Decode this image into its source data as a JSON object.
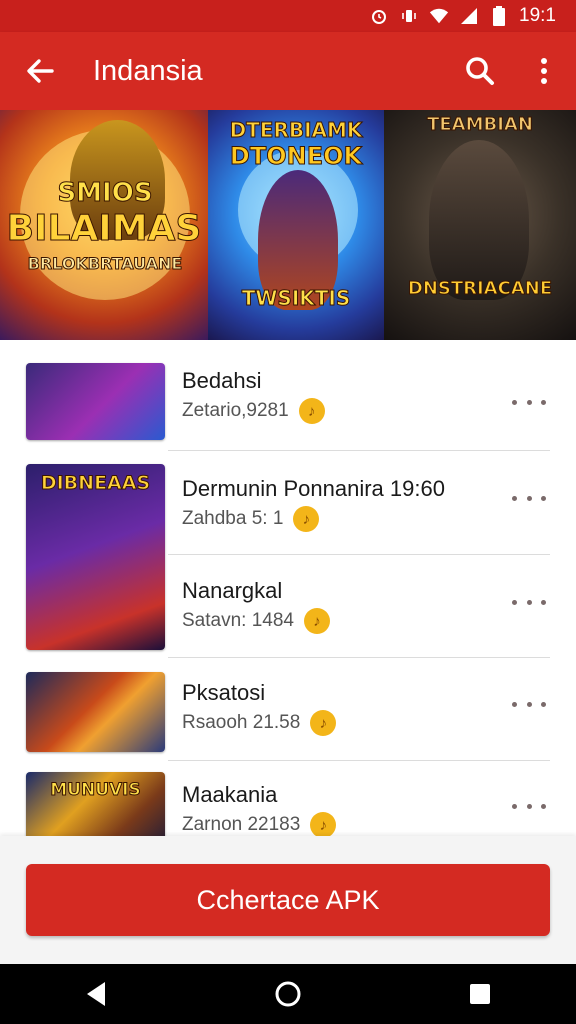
{
  "status_bar": {
    "time": "19:1",
    "icons": [
      "alarm-icon",
      "vibrate-icon",
      "wifi-icon",
      "signal-icon",
      "battery-icon"
    ]
  },
  "app_bar": {
    "title": "Indansia",
    "back_icon": "arrow-left-icon",
    "search_icon": "search-icon",
    "menu_icon": "more-vertical-icon"
  },
  "banner": {
    "tiles": [
      {
        "line1": "SMIOS",
        "line2": "BILAIMAS",
        "line3": "BRLOKBRTAUANE"
      },
      {
        "line1": "DTERBIAMK",
        "line2": "DTONEOK",
        "line3": "TWSIKTIS"
      },
      {
        "line1": "TEAMBIAN",
        "line2": "DNSTRIACANE"
      }
    ]
  },
  "apps": [
    {
      "name": "Bedahsi",
      "meta": "Zetario,9281"
    },
    {
      "name": "Dermunin Ponnanira 19:60",
      "meta": "Zahdba 5: 1"
    },
    {
      "name": "Nanargkal",
      "meta": "Satavn: 1484"
    },
    {
      "name": "Pksatosi",
      "meta": "Rsaooh 21.58"
    },
    {
      "name": "Maakania",
      "meta": "Zarnon 22183"
    }
  ],
  "thumbs": [
    {
      "label": ""
    },
    {
      "label": "DIBNEAAS"
    },
    {
      "label": ""
    },
    {
      "label": ""
    },
    {
      "label": "MUNUVIS"
    }
  ],
  "primary_action": {
    "label": "Cchertace APK"
  },
  "colors": {
    "accent": "#d42a22",
    "coin": "#f3b519"
  }
}
